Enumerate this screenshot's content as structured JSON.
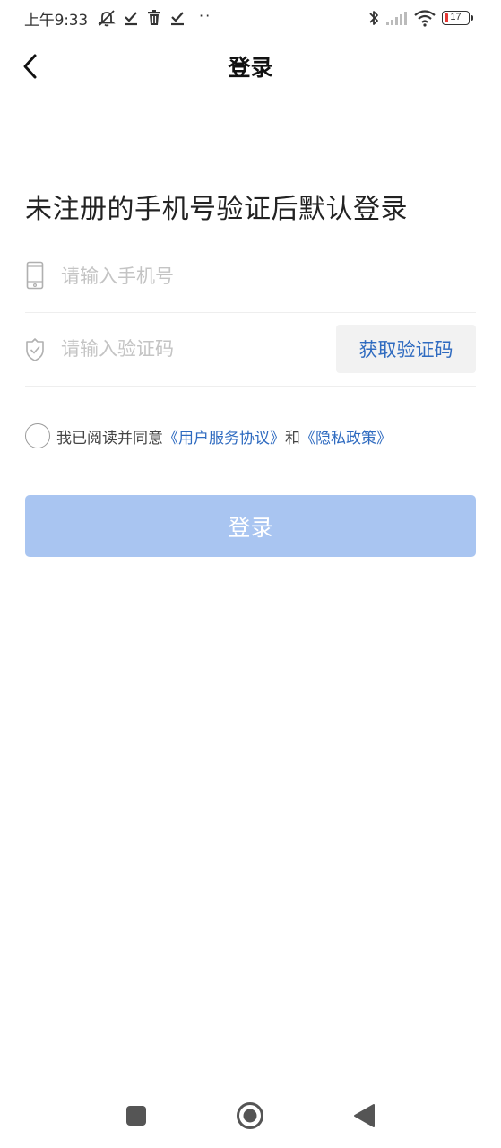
{
  "status_bar": {
    "time": "上午9:33",
    "battery_level": "17",
    "icons": [
      "notification-off-icon",
      "check-icon",
      "trash-icon",
      "check-icon",
      "more-dots-icon",
      "bluetooth-icon",
      "signal-icon",
      "wifi-icon",
      "battery-icon"
    ],
    "more": "··"
  },
  "nav": {
    "title": "登录",
    "back_icon": "chevron-left-icon"
  },
  "main": {
    "heading": "未注册的手机号验证后默认登录",
    "phone_field": {
      "placeholder": "请输入手机号",
      "value": "",
      "icon": "phone-icon"
    },
    "code_field": {
      "placeholder": "请输入验证码",
      "value": "",
      "icon": "shield-check-icon"
    },
    "get_code_label": "获取验证码",
    "agreement": {
      "checked": false,
      "prefix": "我已阅读并同意",
      "user_agreement": "《用户服务协议》",
      "conjunction": "和",
      "privacy_policy": "《隐私政策》"
    },
    "login_label": "登录"
  },
  "system_nav": {
    "icons": [
      "recent-apps-icon",
      "home-icon",
      "back-icon"
    ]
  },
  "colors": {
    "accent": "#2f6bc0",
    "login_button_disabled": "#a9c5f1",
    "placeholder": "#c4c4c4",
    "battery_low": "#e53935"
  }
}
